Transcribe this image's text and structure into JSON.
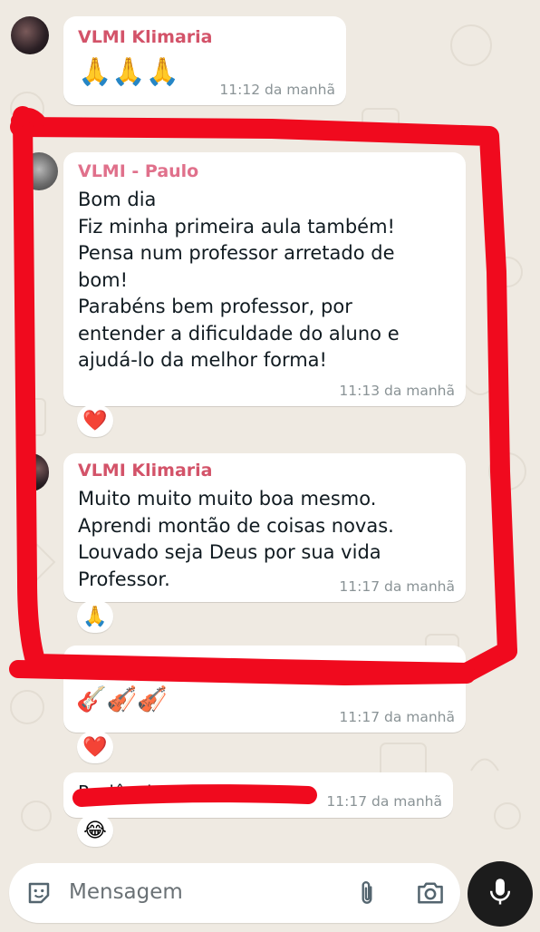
{
  "messages": [
    {
      "sender": "VLMI Klimaria",
      "text": "🙏🙏🙏",
      "time": "11:12 da manhã"
    },
    {
      "sender": "VLMI - Paulo",
      "text": "Bom dia\nFiz minha primeira aula também!\nPensa num professor arretado de bom!\nParabéns bem professor, por entender a dificuldade do aluno e ajudá-lo da melhor forma!",
      "time": "11:13 da manhã",
      "reaction": "❤️"
    },
    {
      "sender": "VLMI Klimaria",
      "text": "Muito muito muito boa mesmo.\nAprendi montão de coisas novas.\nLouvado seja Deus por sua vida Professor.",
      "time": "11:17 da manhã",
      "reaction": "🙏"
    },
    {
      "text": "🎸🎻🎻",
      "time": "11:17 da manhã",
      "reaction": "❤️"
    },
    {
      "text": "Paciência ... kkkkk",
      "time": "11:17 da manhã",
      "reaction": "😂"
    }
  ],
  "composer": {
    "placeholder": "Mensagem"
  },
  "colors": {
    "sender_klimaria": "#d35369",
    "sender_paulo": "#e0708b",
    "annotation_red": "#f00a1e",
    "mic_button": "#1c1c1c"
  },
  "icons": [
    "sticker-icon",
    "attach-icon",
    "camera-icon",
    "mic-icon"
  ]
}
